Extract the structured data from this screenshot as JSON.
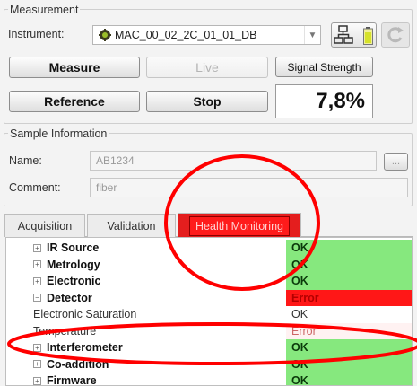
{
  "measurement": {
    "group_title": "Measurement",
    "instrument_label": "Instrument:",
    "instrument_value": "MAC_00_02_2C_01_01_DB",
    "buttons": {
      "measure": "Measure",
      "live": "Live",
      "signal_strength": "Signal Strength",
      "reference": "Reference",
      "stop": "Stop"
    },
    "signal_value": "7,8%"
  },
  "sample": {
    "group_title": "Sample Information",
    "name_label": "Name:",
    "name_value": "AB1234",
    "comment_label": "Comment:",
    "comment_value": "fiber",
    "browse_label": "..."
  },
  "tabs": [
    "Acquisition",
    "Validation",
    "Health Monitoring"
  ],
  "active_tab": "Health Monitoring",
  "tree": [
    {
      "label": "IR Source",
      "status": "OK",
      "state": "ok",
      "expander": "+"
    },
    {
      "label": "Metrology",
      "status": "OK",
      "state": "ok",
      "expander": "+"
    },
    {
      "label": "Electronic",
      "status": "OK",
      "state": "ok",
      "expander": "+"
    },
    {
      "label": "Detector",
      "status": "Error",
      "state": "error",
      "expander": "−"
    },
    {
      "label": "Electronic Saturation",
      "status": "OK",
      "state": "plain",
      "child": true
    },
    {
      "label": "Temperature",
      "status": "Error",
      "state": "plainerr",
      "child": true
    },
    {
      "label": "Interferometer",
      "status": "OK",
      "state": "ok",
      "expander": "+"
    },
    {
      "label": "Co-addition",
      "status": "OK",
      "state": "ok",
      "expander": "+"
    },
    {
      "label": "Firmware",
      "status": "OK",
      "state": "ok",
      "expander": "+"
    }
  ],
  "colors": {
    "ok": "#86e87e",
    "error": "#ff1717",
    "annotation": "#ff0000"
  },
  "icons": [
    "device-icon",
    "network-icon",
    "battery-icon",
    "refresh-icon",
    "chevron-down-icon",
    "expand-icon",
    "collapse-icon"
  ]
}
